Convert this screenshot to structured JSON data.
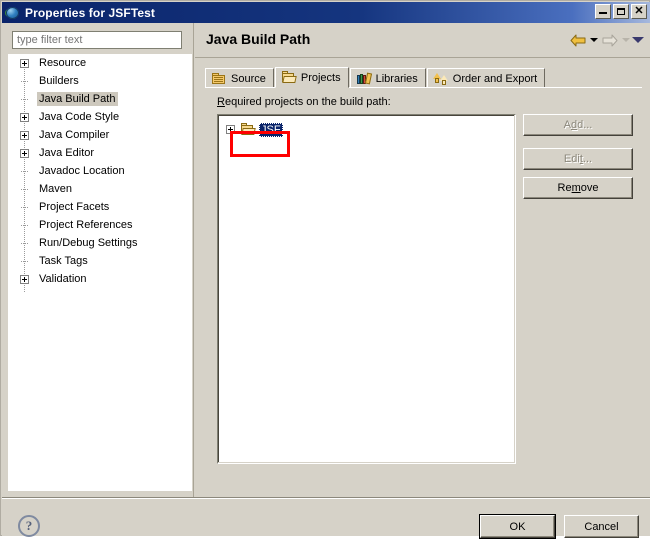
{
  "window": {
    "title": "Properties for JSFTest",
    "icon": "eclipse-globe-icon",
    "controls": {
      "minimize": "minimize-button",
      "maximize": "maximize-button",
      "close_glyph": "✕"
    }
  },
  "sidebar": {
    "filter": {
      "placeholder": "type filter text",
      "value": ""
    },
    "items": [
      {
        "label": "Resource",
        "expandable": true,
        "selected": false
      },
      {
        "label": "Builders",
        "expandable": false,
        "selected": false
      },
      {
        "label": "Java Build Path",
        "expandable": false,
        "selected": true
      },
      {
        "label": "Java Code Style",
        "expandable": true,
        "selected": false
      },
      {
        "label": "Java Compiler",
        "expandable": true,
        "selected": false
      },
      {
        "label": "Java Editor",
        "expandable": true,
        "selected": false
      },
      {
        "label": "Javadoc Location",
        "expandable": false,
        "selected": false
      },
      {
        "label": "Maven",
        "expandable": false,
        "selected": false
      },
      {
        "label": "Project Facets",
        "expandable": false,
        "selected": false
      },
      {
        "label": "Project References",
        "expandable": false,
        "selected": false
      },
      {
        "label": "Run/Debug Settings",
        "expandable": false,
        "selected": false
      },
      {
        "label": "Task Tags",
        "expandable": false,
        "selected": false
      },
      {
        "label": "Validation",
        "expandable": true,
        "selected": false
      }
    ]
  },
  "page": {
    "title": "Java Build Path",
    "nav": {
      "back": "back-arrow",
      "back_menu": "back-history-dropdown",
      "forward": "forward-arrow",
      "forward_menu": "forward-history-dropdown",
      "view_menu": "view-menu-arrow"
    },
    "tabs": [
      {
        "label": "Source",
        "icon": "source-folder-icon",
        "active": false
      },
      {
        "label": "Projects",
        "icon": "open-folder-icon",
        "active": true
      },
      {
        "label": "Libraries",
        "icon": "books-icon",
        "active": false
      },
      {
        "label": "Order and Export",
        "icon": "order-arrows-icon",
        "active": false
      }
    ],
    "projects_tab": {
      "caption_mnemonic": "R",
      "caption_rest": "equired projects on the build path:",
      "list": [
        {
          "label": "JSF",
          "icon": "open-folder-icon",
          "expandable": true,
          "selected": true,
          "annotated": true
        }
      ],
      "buttons": [
        {
          "id": "add",
          "label_pre": "A",
          "label_mn": "d",
          "label_post": "d...",
          "enabled": false
        },
        {
          "id": "edit",
          "label_pre": "Edi",
          "label_mn": "t",
          "label_post": "...",
          "enabled": false
        },
        {
          "id": "remove",
          "label_pre": "Re",
          "label_mn": "m",
          "label_post": "ove",
          "enabled": true
        }
      ]
    }
  },
  "footer": {
    "help": "?",
    "ok": "OK",
    "cancel": "Cancel"
  },
  "colors": {
    "titlebar_start": "#0a246a",
    "dialog_face": "#d6d2c8",
    "selection_blue": "#0a246a",
    "tree_selection_gray": "#cdc8bd",
    "annotation_red": "#ff0000",
    "disabled_text": "#8c887c"
  }
}
